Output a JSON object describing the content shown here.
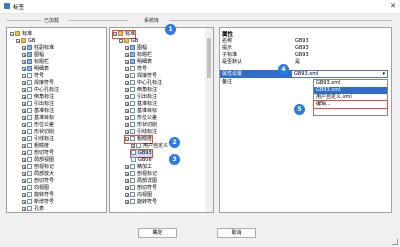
{
  "window": {
    "title": "标签"
  },
  "sections": {
    "loaded": "已加载",
    "hints": "系统库"
  },
  "left_tree": [
    {
      "label": "标准",
      "icon": "folder",
      "toggle": "−"
    },
    {
      "label": "GB",
      "icon": "folder",
      "toggle": "−"
    },
    {
      "label": "柱副标准",
      "icon": "grid",
      "toggle": "+"
    },
    {
      "label": "图幅",
      "icon": "grid",
      "toggle": "+"
    },
    {
      "label": "标题栏",
      "icon": "grid",
      "toggle": "+"
    },
    {
      "label": "明细表",
      "icon": "grid",
      "toggle": "+"
    },
    {
      "label": "符号",
      "icon": "page",
      "toggle": "−"
    },
    {
      "label": "焊接符号",
      "icon": "page",
      "toggle": "+"
    },
    {
      "label": "中心孔标注",
      "icon": "page",
      "toggle": "+"
    },
    {
      "label": "倒角标注",
      "icon": "page",
      "toggle": "+"
    },
    {
      "label": "引出标注",
      "icon": "page",
      "toggle": "+"
    },
    {
      "label": "基准标注",
      "icon": "page",
      "toggle": "+"
    },
    {
      "label": "基准目标",
      "icon": "page",
      "toggle": "+"
    },
    {
      "label": "形位公差",
      "icon": "page",
      "toggle": "+"
    },
    {
      "label": "形状切削",
      "icon": "page",
      "toggle": "+"
    },
    {
      "label": "引线标注",
      "icon": "page",
      "toggle": "+"
    },
    {
      "label": "粗糙度",
      "icon": "page",
      "toggle": "+"
    },
    {
      "label": "剖切符号",
      "icon": "page",
      "toggle": "+"
    },
    {
      "label": "局部视图",
      "icon": "page",
      "toggle": "+"
    },
    {
      "label": "剖视标记",
      "icon": "page",
      "toggle": "+"
    },
    {
      "label": "局部放大",
      "icon": "page",
      "toggle": "+"
    },
    {
      "label": "剖切符号",
      "icon": "page",
      "toggle": "+"
    },
    {
      "label": "向视图",
      "icon": "page",
      "toggle": "+"
    },
    {
      "label": "旋转符号",
      "icon": "page",
      "toggle": "+"
    },
    {
      "label": "新增符号",
      "icon": "page",
      "toggle": "+"
    },
    {
      "label": "孔表",
      "icon": "page",
      "toggle": "+"
    }
  ],
  "mid_tree": [
    {
      "label": "标准",
      "icon": "folder",
      "toggle": "−"
    },
    {
      "label": "GB",
      "icon": "folder",
      "toggle": "−"
    },
    {
      "label": "图幅",
      "icon": "grid",
      "toggle": "+"
    },
    {
      "label": "标题栏",
      "icon": "grid",
      "toggle": "+"
    },
    {
      "label": "明细表",
      "icon": "grid",
      "toggle": "+"
    },
    {
      "label": "符号",
      "icon": "page",
      "toggle": "−"
    },
    {
      "label": "焊接符号",
      "icon": "page",
      "toggle": "+"
    },
    {
      "label": "中心孔标注",
      "icon": "page",
      "toggle": "+"
    },
    {
      "label": "倒角标注",
      "icon": "page",
      "toggle": "+"
    },
    {
      "label": "引出标注",
      "icon": "page",
      "toggle": "+"
    },
    {
      "label": "基准标注",
      "icon": "page",
      "toggle": "+"
    },
    {
      "label": "基准目标",
      "icon": "page",
      "toggle": "+"
    },
    {
      "label": "形位公差",
      "icon": "page",
      "toggle": "+"
    },
    {
      "label": "形状切削",
      "icon": "page",
      "toggle": "+"
    },
    {
      "label": "引线标注",
      "icon": "page",
      "toggle": "+"
    },
    {
      "label": "粗糙度",
      "icon": "page",
      "toggle": "−"
    },
    {
      "label": "用户自定义",
      "icon": "page",
      "toggle": "+"
    },
    {
      "label": "GB93",
      "icon": "page",
      "toggle": ""
    },
    {
      "label": "GB06",
      "icon": "page",
      "toggle": ""
    },
    {
      "label": "精加工",
      "icon": "page",
      "toggle": "+"
    },
    {
      "label": "剖视标记",
      "icon": "page",
      "toggle": "+"
    },
    {
      "label": "局部详图",
      "icon": "page",
      "toggle": "+"
    },
    {
      "label": "剖切符号",
      "icon": "page",
      "toggle": "+"
    },
    {
      "label": "向视图",
      "icon": "page",
      "toggle": "+"
    },
    {
      "label": "旋转符号",
      "icon": "page",
      "toggle": "+"
    }
  ],
  "properties": {
    "header": "属性",
    "rows": [
      {
        "key": "名称",
        "value": "GB93"
      },
      {
        "key": "提示",
        "value": "GB93"
      },
      {
        "key": "子标准",
        "value": "GB93"
      },
      {
        "key": "是否默认",
        "value": "是"
      }
    ],
    "settings_key": "属性设置",
    "settings_value": "GB93.xml",
    "note_key": "备注",
    "options": [
      "GB93.xml",
      "GB93.xml",
      "用户自定义.xml",
      "编辑..."
    ]
  },
  "badges": [
    "1",
    "2",
    "3",
    "4",
    "5"
  ],
  "buttons": {
    "ok": "确定",
    "cancel": "取消"
  },
  "colors": {
    "accent": "#2c7be5",
    "highlight": "#e74c3c",
    "selection": "#2f6dc6"
  }
}
